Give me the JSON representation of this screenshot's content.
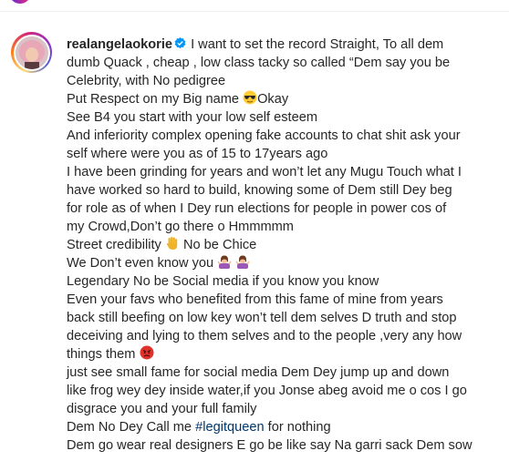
{
  "post": {
    "username": "realangelaokorie",
    "verified": true,
    "lines": [
      "I want to set the record Straight, To all dem",
      "dumb Quack , cheap , low class tacky so called “Dem say you be",
      "Celebrity, with No pedigree",
      "Put Respect on my Big name",
      "Okay",
      "See B4 you start with your low self esteem",
      "And inferiority complex opening fake accounts to chat shit ask your",
      "self where were you as of 15 to 17years ago",
      "I have been grinding for years and won’t let any Mugu Touch what I",
      "have worked so hard to build, knowing some of Dem still Dey beg",
      "for role as of when I Dey run elections for people in power cos of",
      "my Crowd,Don’t go there o Hmmmmm",
      "Street credibility",
      "No be Chice",
      "We Don’t even know you",
      "Legendary No be Social media if you know you know",
      "Even your favs who benefited from this fame of mine from years",
      "back still beefing on low key won’t tell dem selves D truth and stop",
      "deceiving and lying to them selves and to the people ,very any how",
      "things them",
      "just see small fame for social media Dem Dey jump up and down",
      "like frog wey dey inside water,if you Jonse abeg avoid me o cos I go",
      "disgrace you and your full family",
      "Dem No Dey Call me",
      "#legitqueen",
      "for nothing",
      "Dem go wear real designers E go be like say Na garri sack Dem sow"
    ]
  },
  "icons": {
    "verified": "verified-badge-icon",
    "sunglasses": "sunglasses-emoji-icon",
    "hand": "raised-hand-emoji-icon",
    "shrug": "woman-shrugging-emoji-icon",
    "angry": "angry-face-emoji-icon"
  },
  "colors": {
    "text": "#262626",
    "hashtag": "#00376b",
    "verified": "#0095f6",
    "angry": "#e0322b"
  }
}
